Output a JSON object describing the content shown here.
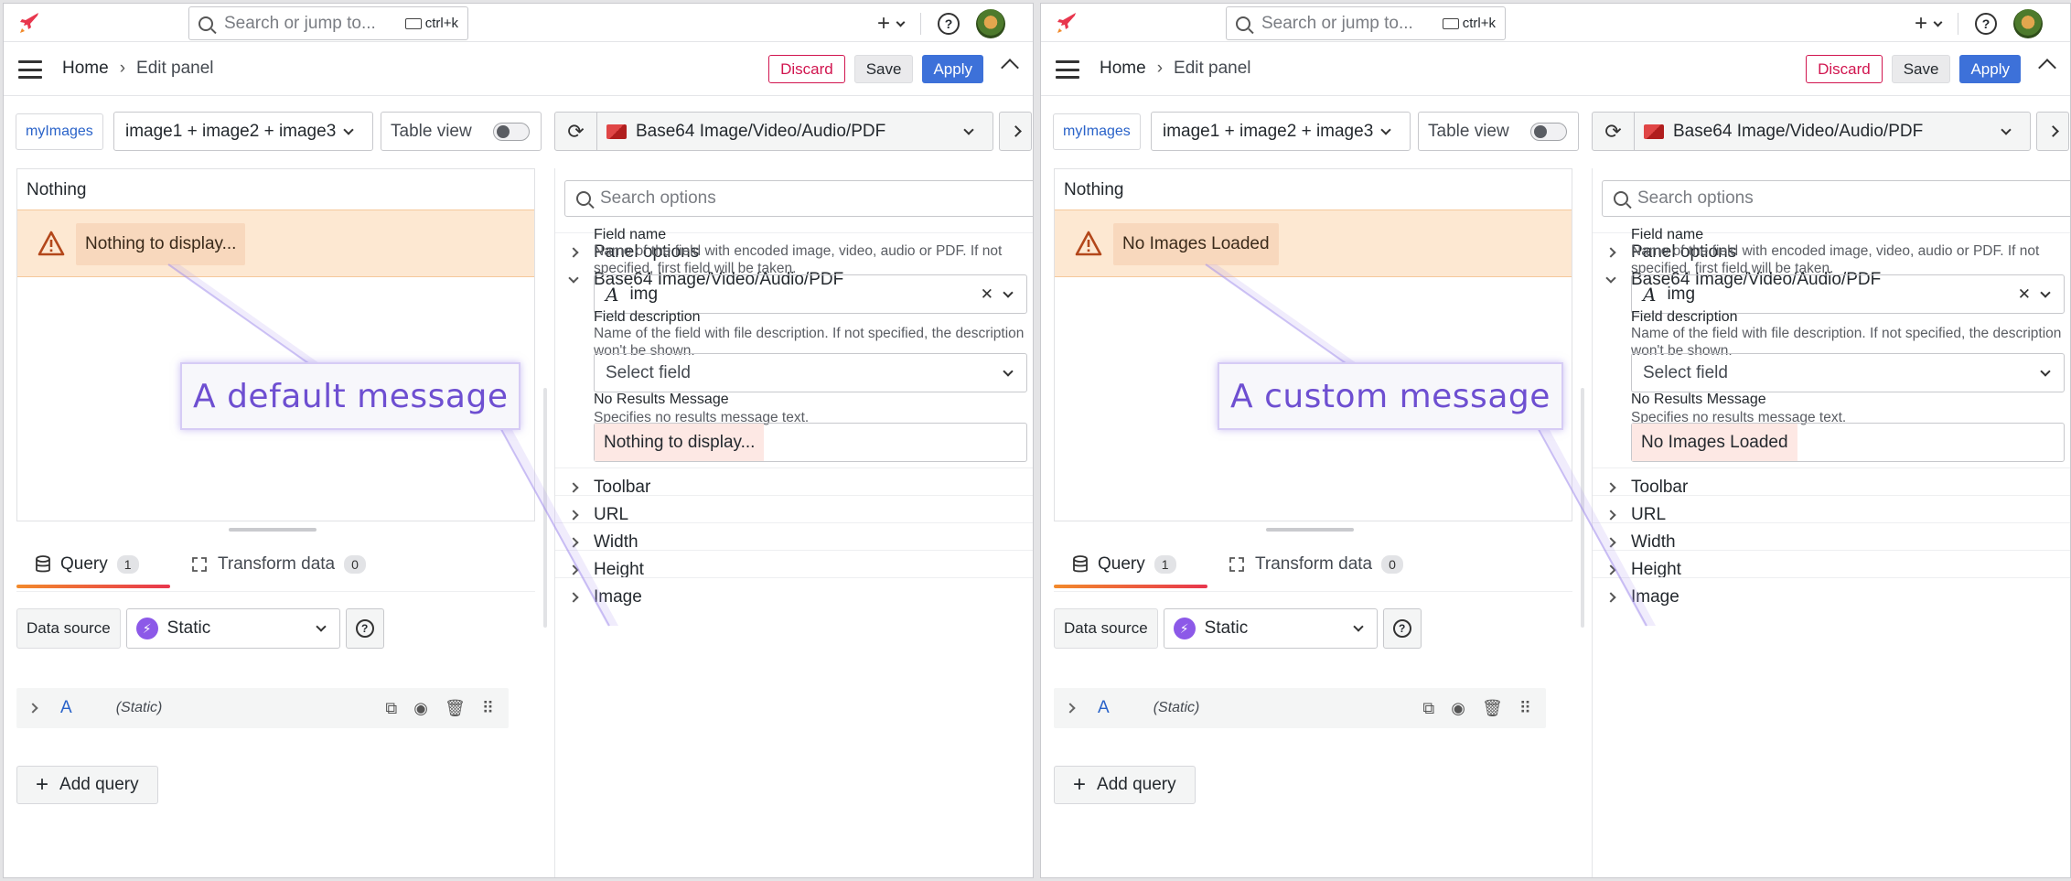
{
  "screens": [
    {
      "search": {
        "placeholder": "Search or jump to...",
        "shortcut": "ctrl+k"
      },
      "breadcrumb": {
        "home": "Home",
        "current": "Edit panel"
      },
      "buttons": {
        "discard": "Discard",
        "save": "Save",
        "apply": "Apply"
      },
      "datasource_pill": "myImages",
      "variable_select": "image1 + image2 + image3",
      "table_view": "Table view",
      "visualization": "Base64 Image/Video/Audio/PDF",
      "panel_title": "Nothing",
      "alert_text": "Nothing to display...",
      "callout": "A default message",
      "query_tabs": [
        {
          "label": "Query",
          "count": "1"
        },
        {
          "label": "Transform data",
          "count": "0"
        }
      ],
      "data_source_label": "Data source",
      "data_source_value": "Static",
      "query_row": {
        "name": "A",
        "datasource": "(Static)"
      },
      "add_query": "Add query",
      "options": {
        "search_placeholder": "Search options",
        "panel_options": "Panel options",
        "section_title": "Base64 Image/Video/Audio/PDF",
        "field_name_label": "Field name",
        "field_name_desc": "Name of the field with encoded image, video, audio or PDF. If not specified, first field will be taken.",
        "field_name_value": "img",
        "field_desc_label": "Field description",
        "field_desc_desc": "Name of the field with file description. If not specified, the description won't be shown.",
        "field_desc_placeholder": "Select field",
        "no_results_label": "No Results Message",
        "no_results_desc": "Specifies no results message text.",
        "no_results_value": "Nothing to display...",
        "sections": [
          "Toolbar",
          "URL",
          "Width",
          "Height",
          "Image"
        ]
      }
    },
    {
      "search": {
        "placeholder": "Search or jump to...",
        "shortcut": "ctrl+k"
      },
      "breadcrumb": {
        "home": "Home",
        "current": "Edit panel"
      },
      "buttons": {
        "discard": "Discard",
        "save": "Save",
        "apply": "Apply"
      },
      "datasource_pill": "myImages",
      "variable_select": "image1 + image2 + image3",
      "table_view": "Table view",
      "visualization": "Base64 Image/Video/Audio/PDF",
      "panel_title": "Nothing",
      "alert_text": "No Images Loaded",
      "callout": "A custom message",
      "query_tabs": [
        {
          "label": "Query",
          "count": "1"
        },
        {
          "label": "Transform data",
          "count": "0"
        }
      ],
      "data_source_label": "Data source",
      "data_source_value": "Static",
      "query_row": {
        "name": "A",
        "datasource": "(Static)"
      },
      "add_query": "Add query",
      "options": {
        "search_placeholder": "Search options",
        "panel_options": "Panel options",
        "section_title": "Base64 Image/Video/Audio/PDF",
        "field_name_label": "Field name",
        "field_name_desc": "Name of the field with encoded image, video, audio or PDF. If not specified, first field will be taken.",
        "field_name_value": "img",
        "field_desc_label": "Field description",
        "field_desc_desc": "Name of the field with file description. If not specified, the description won't be shown.",
        "field_desc_placeholder": "Select field",
        "no_results_label": "No Results Message",
        "no_results_desc": "Specifies no results message text.",
        "no_results_value": "No Images Loaded",
        "sections": [
          "Toolbar",
          "URL",
          "Width",
          "Height",
          "Image"
        ]
      }
    }
  ],
  "colors": {
    "accent": "#3d71d9",
    "discard": "#d1154f",
    "alert_bg": "#fde8d2",
    "callout_text": "#6e4fd1"
  }
}
